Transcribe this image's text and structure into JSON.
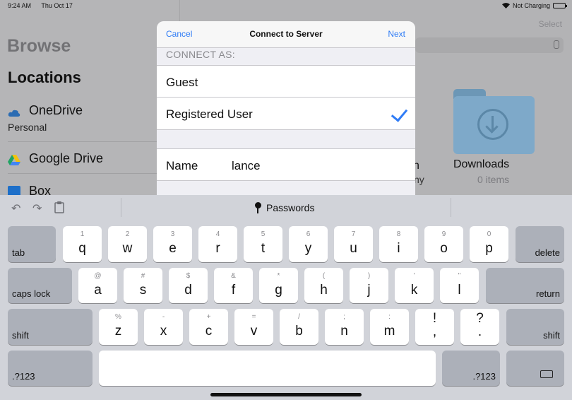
{
  "status_bar": {
    "time": "9:24 AM",
    "date": "Thu Oct 17",
    "battery_text": "Not Charging"
  },
  "sidebar": {
    "title": "Browse",
    "section": "Locations",
    "items": [
      {
        "label": "OneDrive",
        "sub": "Personal"
      },
      {
        "label": "Google Drive"
      },
      {
        "label": "Box"
      }
    ]
  },
  "content": {
    "select_label": "Select",
    "partial_text_1": "n",
    "partial_text_2": "ny",
    "folder": {
      "name": "Downloads",
      "count": "0 items"
    }
  },
  "modal": {
    "cancel_label": "Cancel",
    "title": "Connect to Server",
    "next_label": "Next",
    "section_header": "CONNECT AS:",
    "options": [
      {
        "label": "Guest",
        "selected": false
      },
      {
        "label": "Registered User",
        "selected": true
      }
    ],
    "name_label": "Name",
    "name_value": "lance"
  },
  "keyboard": {
    "toolbar_label": "Passwords",
    "row1": [
      {
        "main": "q",
        "alt": "1"
      },
      {
        "main": "w",
        "alt": "2"
      },
      {
        "main": "e",
        "alt": "3"
      },
      {
        "main": "r",
        "alt": "4"
      },
      {
        "main": "t",
        "alt": "5"
      },
      {
        "main": "y",
        "alt": "6"
      },
      {
        "main": "u",
        "alt": "7"
      },
      {
        "main": "i",
        "alt": "8"
      },
      {
        "main": "o",
        "alt": "9"
      },
      {
        "main": "p",
        "alt": "0"
      }
    ],
    "row2": [
      {
        "main": "a",
        "alt": "@"
      },
      {
        "main": "s",
        "alt": "#"
      },
      {
        "main": "d",
        "alt": "$"
      },
      {
        "main": "f",
        "alt": "&"
      },
      {
        "main": "g",
        "alt": "*"
      },
      {
        "main": "h",
        "alt": "("
      },
      {
        "main": "j",
        "alt": ")"
      },
      {
        "main": "k",
        "alt": "'"
      },
      {
        "main": "l",
        "alt": "\""
      }
    ],
    "row3": [
      {
        "main": "z",
        "alt": "%"
      },
      {
        "main": "x",
        "alt": "-"
      },
      {
        "main": "c",
        "alt": "+"
      },
      {
        "main": "v",
        "alt": "="
      },
      {
        "main": "b",
        "alt": "/"
      },
      {
        "main": "n",
        "alt": ";"
      },
      {
        "main": "m",
        "alt": ":"
      },
      {
        "main": ",",
        "alt": "!"
      },
      {
        "main": ".",
        "alt": "?"
      }
    ],
    "tab": "tab",
    "delete": "delete",
    "caps_lock": "caps lock",
    "return": "return",
    "shift": "shift",
    "numbers": ".?123"
  },
  "colors": {
    "accent": "#2f7cf6"
  }
}
